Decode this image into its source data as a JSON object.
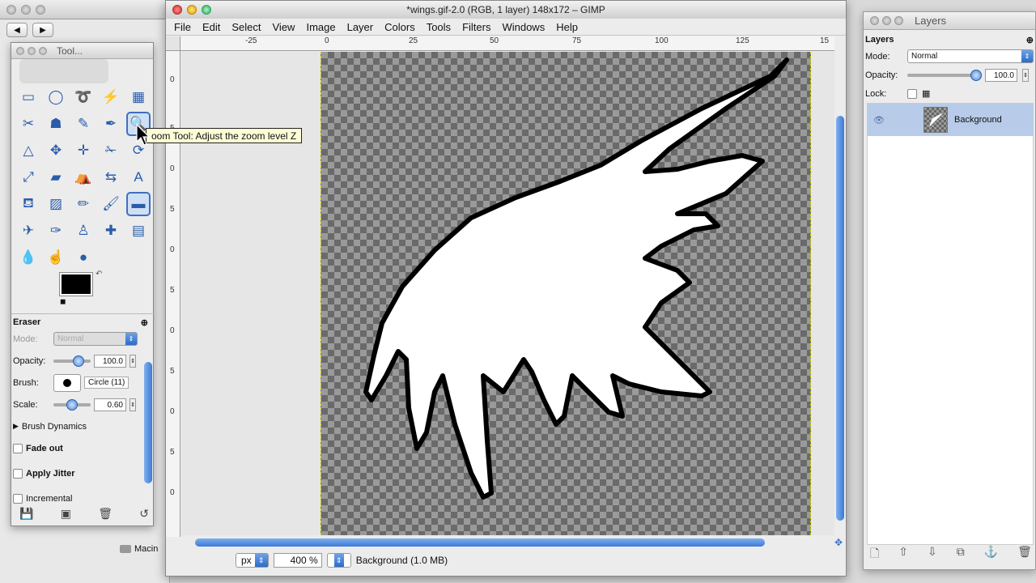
{
  "background_app": {
    "bottom_label": "Macin"
  },
  "toolbox": {
    "title": "Tool...",
    "tooltip": "oom Tool: Adjust the zoom level  Z",
    "tool_options": {
      "tool_name": "Eraser",
      "mode_label": "Mode:",
      "mode_value": "Normal",
      "opacity_label": "Opacity:",
      "opacity_value": "100.0",
      "brush_label": "Brush:",
      "brush_value": "Circle (11)",
      "scale_label": "Scale:",
      "scale_value": "0.60",
      "brush_dynamics": "Brush Dynamics",
      "fade_out": "Fade out",
      "apply_jitter": "Apply Jitter",
      "incremental": "Incremental"
    }
  },
  "image_window": {
    "title": "*wings.gif-2.0 (RGB, 1 layer) 148x172 – GIMP",
    "menu": [
      "File",
      "Edit",
      "Select",
      "View",
      "Image",
      "Layer",
      "Colors",
      "Tools",
      "Filters",
      "Windows",
      "Help"
    ],
    "ruler_top_ticks": [
      "-25",
      "0",
      "25",
      "50",
      "75",
      "100",
      "125",
      "15"
    ],
    "ruler_left_ticks": [
      "0",
      "5",
      "0",
      "5",
      "0",
      "5",
      "0",
      "5",
      "0",
      "5",
      "0"
    ],
    "status": {
      "unit": "px",
      "zoom": "400 %",
      "info": "Background (1.0 MB)"
    }
  },
  "layers": {
    "title": "Layers",
    "heading": "Layers",
    "mode_label": "Mode:",
    "mode_value": "Normal",
    "opacity_label": "Opacity:",
    "opacity_value": "100.0",
    "lock_label": "Lock:",
    "items": [
      {
        "name": "Background"
      }
    ]
  },
  "colors": {
    "accent": "#3c7ad6",
    "selected_row": "#b8cbe8",
    "foreground": "#000000",
    "background": "#ffffff"
  }
}
